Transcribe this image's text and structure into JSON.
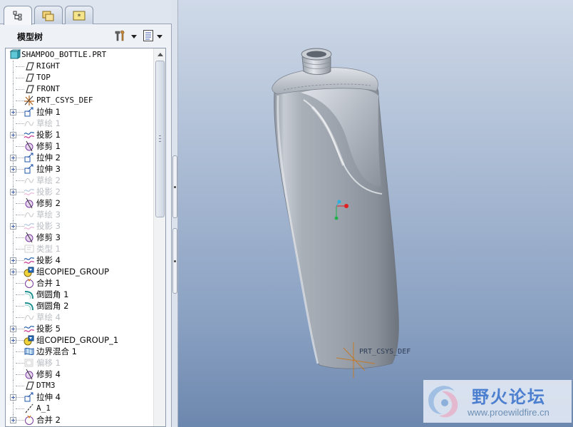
{
  "navigator": {
    "tabs": [
      {
        "name": "model-tree-tab",
        "icon": "model-tree-icon",
        "active": true
      },
      {
        "name": "folder-browser-tab",
        "icon": "folder-browser-icon",
        "active": false
      },
      {
        "name": "favorites-tab",
        "icon": "favorites-icon",
        "active": false
      }
    ],
    "title": "模型树",
    "settings_icon": "tools-icon",
    "show_icon": "list-icon"
  },
  "tree": {
    "root": "SHAMPOO_BOTTLE.PRT",
    "items": [
      {
        "label": "RIGHT",
        "icon": "datum-plane-icon",
        "expandable": false,
        "dim": false
      },
      {
        "label": "TOP",
        "icon": "datum-plane-icon",
        "expandable": false,
        "dim": false
      },
      {
        "label": "FRONT",
        "icon": "datum-plane-icon",
        "expandable": false,
        "dim": false
      },
      {
        "label": "PRT_CSYS_DEF",
        "icon": "csys-icon",
        "expandable": false,
        "dim": false
      },
      {
        "label": "拉伸 1",
        "icon": "extrude-icon",
        "expandable": true,
        "dim": false
      },
      {
        "label": "草绘 1",
        "icon": "sketch-icon",
        "expandable": false,
        "dim": true
      },
      {
        "label": "投影 1",
        "icon": "projection-icon",
        "expandable": true,
        "dim": false
      },
      {
        "label": "修剪 1",
        "icon": "trim-icon",
        "expandable": false,
        "dim": false
      },
      {
        "label": "拉伸 2",
        "icon": "extrude-icon",
        "expandable": true,
        "dim": false
      },
      {
        "label": "拉伸 3",
        "icon": "extrude-icon",
        "expandable": true,
        "dim": false
      },
      {
        "label": "草绘 2",
        "icon": "sketch-icon",
        "expandable": false,
        "dim": true
      },
      {
        "label": "投影 2",
        "icon": "projection-icon",
        "expandable": true,
        "dim": true
      },
      {
        "label": "修剪 2",
        "icon": "trim-icon",
        "expandable": false,
        "dim": false
      },
      {
        "label": "草绘 3",
        "icon": "sketch-icon",
        "expandable": false,
        "dim": true
      },
      {
        "label": "投影 3",
        "icon": "projection-icon",
        "expandable": true,
        "dim": true
      },
      {
        "label": "修剪 3",
        "icon": "trim-icon",
        "expandable": false,
        "dim": false
      },
      {
        "label": "类型 1",
        "icon": "type-icon",
        "expandable": false,
        "dim": true
      },
      {
        "label": "投影 4",
        "icon": "projection-icon",
        "expandable": true,
        "dim": false
      },
      {
        "label": "组COPIED_GROUP",
        "icon": "group-icon",
        "expandable": true,
        "dim": false
      },
      {
        "label": "合并 1",
        "icon": "merge-icon",
        "expandable": false,
        "dim": false
      },
      {
        "label": "倒圆角 1",
        "icon": "round-icon",
        "expandable": false,
        "dim": false
      },
      {
        "label": "倒圆角 2",
        "icon": "round-icon",
        "expandable": false,
        "dim": false
      },
      {
        "label": "草绘 4",
        "icon": "sketch-icon",
        "expandable": false,
        "dim": true
      },
      {
        "label": "投影 5",
        "icon": "projection-icon",
        "expandable": true,
        "dim": false
      },
      {
        "label": "组COPIED_GROUP_1",
        "icon": "group-icon",
        "expandable": true,
        "dim": false
      },
      {
        "label": "边界混合 1",
        "icon": "boundary-blend-icon",
        "expandable": false,
        "dim": false
      },
      {
        "label": "偏移 1",
        "icon": "offset-icon",
        "expandable": false,
        "dim": true
      },
      {
        "label": "修剪 4",
        "icon": "trim-icon",
        "expandable": false,
        "dim": false
      },
      {
        "label": "DTM3",
        "icon": "datum-plane-icon",
        "expandable": false,
        "dim": false
      },
      {
        "label": "拉伸 4",
        "icon": "extrude-icon",
        "expandable": true,
        "dim": false
      },
      {
        "label": "A_1",
        "icon": "datum-axis-icon",
        "expandable": false,
        "dim": false
      },
      {
        "label": "合并 2",
        "icon": "merge-icon",
        "expandable": true,
        "dim": false
      }
    ]
  },
  "viewport": {
    "csys_label": "PRT_CSYS_DEF",
    "model": "shampoo-bottle"
  },
  "watermark": {
    "title": "野火论坛",
    "url": "www.proewildfire.cn"
  },
  "colors": {
    "csys_x": "#e02020",
    "csys_y": "#22b14c",
    "csys_z": "#2ab0e0"
  }
}
